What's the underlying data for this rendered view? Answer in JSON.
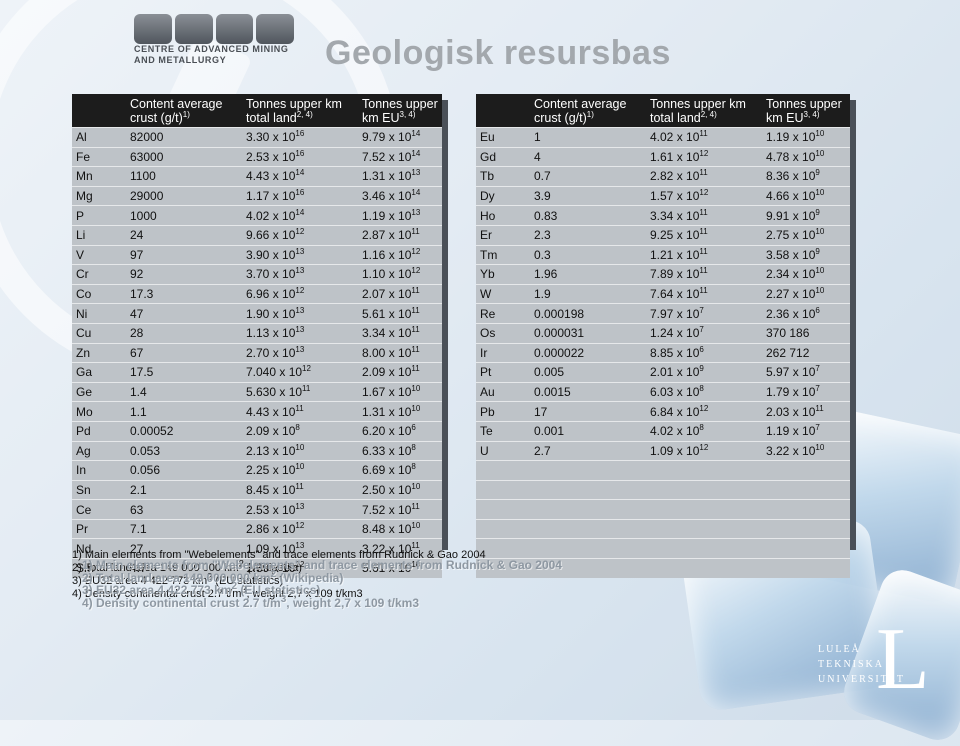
{
  "logo": {
    "mark_letters": "CAMM",
    "lines": [
      "CENTRE OF ADVANCED MINING",
      "AND METALLURGY"
    ]
  },
  "title": "Geologisk resursbas",
  "table_left": {
    "headers": [
      {
        "main": "",
        "sup": ""
      },
      {
        "main": "Content average crust (g/t)",
        "sup": "1)"
      },
      {
        "main": "Tonnes upper km total land",
        "sup": "2, 4)"
      },
      {
        "main": "Tonnes upper km EU",
        "sup": "3, 4)"
      }
    ],
    "rows": [
      {
        "el": "Al",
        "content": "82000",
        "land": {
          "m": "3.30 x 10",
          "e": "16"
        },
        "eu": {
          "m": "9.79 x 10",
          "e": "14"
        }
      },
      {
        "el": "Fe",
        "content": "63000",
        "land": {
          "m": "2.53 x 10",
          "e": "16"
        },
        "eu": {
          "m": "7.52 x 10",
          "e": "14"
        }
      },
      {
        "el": "Mn",
        "content": "1100",
        "land": {
          "m": "4.43 x 10",
          "e": "14"
        },
        "eu": {
          "m": "1.31 x 10",
          "e": "13"
        }
      },
      {
        "el": "Mg",
        "content": "29000",
        "land": {
          "m": "1.17 x 10",
          "e": "16"
        },
        "eu": {
          "m": "3.46 x 10",
          "e": "14"
        }
      },
      {
        "el": "P",
        "content": "1000",
        "land": {
          "m": "4.02 x 10",
          "e": "14"
        },
        "eu": {
          "m": "1.19 x 10",
          "e": "13"
        }
      },
      {
        "el": "Li",
        "content": "24",
        "land": {
          "m": "9.66 x 10",
          "e": "12"
        },
        "eu": {
          "m": "2.87 x 10",
          "e": "11"
        }
      },
      {
        "el": "V",
        "content": "97",
        "land": {
          "m": "3.90 x 10",
          "e": "13"
        },
        "eu": {
          "m": "1.16 x 10",
          "e": "12"
        }
      },
      {
        "el": "Cr",
        "content": "92",
        "land": {
          "m": "3.70 x 10",
          "e": "13"
        },
        "eu": {
          "m": "1.10 x 10",
          "e": "12"
        }
      },
      {
        "el": "Co",
        "content": "17.3",
        "land": {
          "m": "6.96 x 10",
          "e": "12"
        },
        "eu": {
          "m": "2.07 x 10",
          "e": "11"
        }
      },
      {
        "el": "Ni",
        "content": "47",
        "land": {
          "m": "1.90 x 10",
          "e": "13"
        },
        "eu": {
          "m": "5.61 x 10",
          "e": "11"
        }
      },
      {
        "el": "Cu",
        "content": "28",
        "land": {
          "m": "1.13 x 10",
          "e": "13"
        },
        "eu": {
          "m": "3.34 x 10",
          "e": "11"
        }
      },
      {
        "el": "Zn",
        "content": "67",
        "land": {
          "m": "2.70 x 10",
          "e": "13"
        },
        "eu": {
          "m": "8.00 x 10",
          "e": "11"
        }
      },
      {
        "el": "Ga",
        "content": "17.5",
        "land": {
          "m": "7.040 x 10",
          "e": "12"
        },
        "eu": {
          "m": "2.09 x 10",
          "e": "11"
        }
      },
      {
        "el": "Ge",
        "content": "1.4",
        "land": {
          "m": "5.630 x 10",
          "e": "11"
        },
        "eu": {
          "m": "1.67 x 10",
          "e": "10"
        }
      },
      {
        "el": "Mo",
        "content": "1.1",
        "land": {
          "m": "4.43 x 10",
          "e": "11"
        },
        "eu": {
          "m": "1.31 x 10",
          "e": "10"
        }
      },
      {
        "el": "Pd",
        "content": "0.00052",
        "land": {
          "m": "2.09 x 10",
          "e": "8"
        },
        "eu": {
          "m": "6.20 x 10",
          "e": "6"
        }
      },
      {
        "el": "Ag",
        "content": "0.053",
        "land": {
          "m": "2.13 x 10",
          "e": "10"
        },
        "eu": {
          "m": "6.33 x 10",
          "e": "8"
        }
      },
      {
        "el": "In",
        "content": "0.056",
        "land": {
          "m": "2.25 x 10",
          "e": "10"
        },
        "eu": {
          "m": "6.69 x 10",
          "e": "8"
        }
      },
      {
        "el": "Sn",
        "content": "2.1",
        "land": {
          "m": "8.45 x 10",
          "e": "11"
        },
        "eu": {
          "m": "2.50 x 10",
          "e": "10"
        }
      },
      {
        "el": "Ce",
        "content": "63",
        "land": {
          "m": "2.53 x 10",
          "e": "13"
        },
        "eu": {
          "m": "7.52 x 10",
          "e": "11"
        }
      },
      {
        "el": "Pr",
        "content": "7.1",
        "land": {
          "m": "2.86 x 10",
          "e": "12"
        },
        "eu": {
          "m": "8.48 x 10",
          "e": "10"
        }
      },
      {
        "el": "Nd",
        "content": "27",
        "land": {
          "m": "1.09 x 10",
          "e": "13"
        },
        "eu": {
          "m": "3.22 x 10",
          "e": "11"
        }
      },
      {
        "el": "Sm",
        "content": "4.7",
        "land": {
          "m": "1.89 x 10",
          "e": "12"
        },
        "eu": {
          "m": "5.61 x 10",
          "e": "10"
        }
      }
    ]
  },
  "table_right": {
    "headers": [
      {
        "main": "",
        "sup": ""
      },
      {
        "main": "Content average crust (g/t)",
        "sup": "1)"
      },
      {
        "main": "Tonnes upper km total land",
        "sup": "2, 4)"
      },
      {
        "main": "Tonnes upper km EU",
        "sup": "3, 4)"
      }
    ],
    "rows": [
      {
        "el": "Eu",
        "content": "1",
        "land": {
          "m": "4.02 x 10",
          "e": "11"
        },
        "eu": {
          "m": "1.19 x 10",
          "e": "10"
        }
      },
      {
        "el": "Gd",
        "content": "4",
        "land": {
          "m": "1.61 x 10",
          "e": "12"
        },
        "eu": {
          "m": "4.78 x 10",
          "e": "10"
        }
      },
      {
        "el": "Tb",
        "content": "0.7",
        "land": {
          "m": "2.82 x 10",
          "e": "11"
        },
        "eu": {
          "m": "8.36 x 10",
          "e": "9"
        }
      },
      {
        "el": "Dy",
        "content": "3.9",
        "land": {
          "m": "1.57 x 10",
          "e": "12"
        },
        "eu": {
          "m": "4.66 x 10",
          "e": "10"
        }
      },
      {
        "el": "Ho",
        "content": "0.83",
        "land": {
          "m": "3.34 x 10",
          "e": "11"
        },
        "eu": {
          "m": "9.91 x 10",
          "e": "9"
        }
      },
      {
        "el": "Er",
        "content": "2.3",
        "land": {
          "m": "9.25 x 10",
          "e": "11"
        },
        "eu": {
          "m": "2.75 x 10",
          "e": "10"
        }
      },
      {
        "el": "Tm",
        "content": "0.3",
        "land": {
          "m": "1.21 x 10",
          "e": "11"
        },
        "eu": {
          "m": "3.58 x 10",
          "e": "9"
        }
      },
      {
        "el": "Yb",
        "content": "1.96",
        "land": {
          "m": "7.89 x 10",
          "e": "11"
        },
        "eu": {
          "m": "2.34 x 10",
          "e": "10"
        }
      },
      {
        "el": "W",
        "content": "1.9",
        "land": {
          "m": "7.64 x 10",
          "e": "11"
        },
        "eu": {
          "m": "2.27 x 10",
          "e": "10"
        }
      },
      {
        "el": "Re",
        "content": "0.000198",
        "land": {
          "m": "7.97 x 10",
          "e": "7"
        },
        "eu": {
          "m": "2.36 x 10",
          "e": "6"
        }
      },
      {
        "el": "Os",
        "content": "0.000031",
        "land": {
          "m": "1.24 x 10",
          "e": "7"
        },
        "eu": {
          "m": "370 186",
          "e": ""
        }
      },
      {
        "el": "Ir",
        "content": "0.000022",
        "land": {
          "m": "8.85 x 10",
          "e": "6"
        },
        "eu": {
          "m": "262 712",
          "e": ""
        }
      },
      {
        "el": "Pt",
        "content": "0.005",
        "land": {
          "m": "2.01 x 10",
          "e": "9"
        },
        "eu": {
          "m": "5.97 x 10",
          "e": "7"
        }
      },
      {
        "el": "Au",
        "content": "0.0015",
        "land": {
          "m": "6.03 x 10",
          "e": "8"
        },
        "eu": {
          "m": "1.79 x 10",
          "e": "7"
        }
      },
      {
        "el": "Pb",
        "content": "17",
        "land": {
          "m": "6.84 x 10",
          "e": "12"
        },
        "eu": {
          "m": "2.03 x 10",
          "e": "11"
        }
      },
      {
        "el": "Te",
        "content": "0.001",
        "land": {
          "m": "4.02 x 10",
          "e": "8"
        },
        "eu": {
          "m": "1.19 x 10",
          "e": "7"
        }
      },
      {
        "el": "U",
        "content": "2.7",
        "land": {
          "m": "1.09 x 10",
          "e": "12"
        },
        "eu": {
          "m": "3.22 x 10",
          "e": "10"
        }
      },
      {
        "el": "",
        "content": "",
        "land": {
          "m": "",
          "e": ""
        },
        "eu": {
          "m": "",
          "e": ""
        }
      },
      {
        "el": "",
        "content": "",
        "land": {
          "m": "",
          "e": ""
        },
        "eu": {
          "m": "",
          "e": ""
        }
      },
      {
        "el": "",
        "content": "",
        "land": {
          "m": "",
          "e": ""
        },
        "eu": {
          "m": "",
          "e": ""
        }
      },
      {
        "el": "",
        "content": "",
        "land": {
          "m": "",
          "e": ""
        },
        "eu": {
          "m": "",
          "e": ""
        }
      },
      {
        "el": "",
        "content": "",
        "land": {
          "m": "",
          "e": ""
        },
        "eu": {
          "m": "",
          "e": ""
        }
      },
      {
        "el": "",
        "content": "",
        "land": {
          "m": "",
          "e": ""
        },
        "eu": {
          "m": "",
          "e": ""
        }
      }
    ]
  },
  "footnotes": [
    {
      "text": "1)   Main elements from \"Webelements\" and trace elements from Rudnick & Gao 2004",
      "sup": "",
      "tail": ""
    },
    {
      "text": "2)   Total land area 149 000 000 km",
      "sup": "2",
      "tail": " (Wikipedia)"
    },
    {
      "text": "3)   EU32 area 4 422 773 km",
      "sup": "2",
      "tail": " (EU statistics)"
    },
    {
      "text": "4)   Density continental crust 2.7 t/m",
      "sup": "3",
      "tail": ", weight 2,7 x 109 t/km3"
    }
  ],
  "university": {
    "lines": [
      "LULEÅ",
      "TEKNISKA",
      "UNIVERSITET"
    ],
    "mark": "L"
  }
}
